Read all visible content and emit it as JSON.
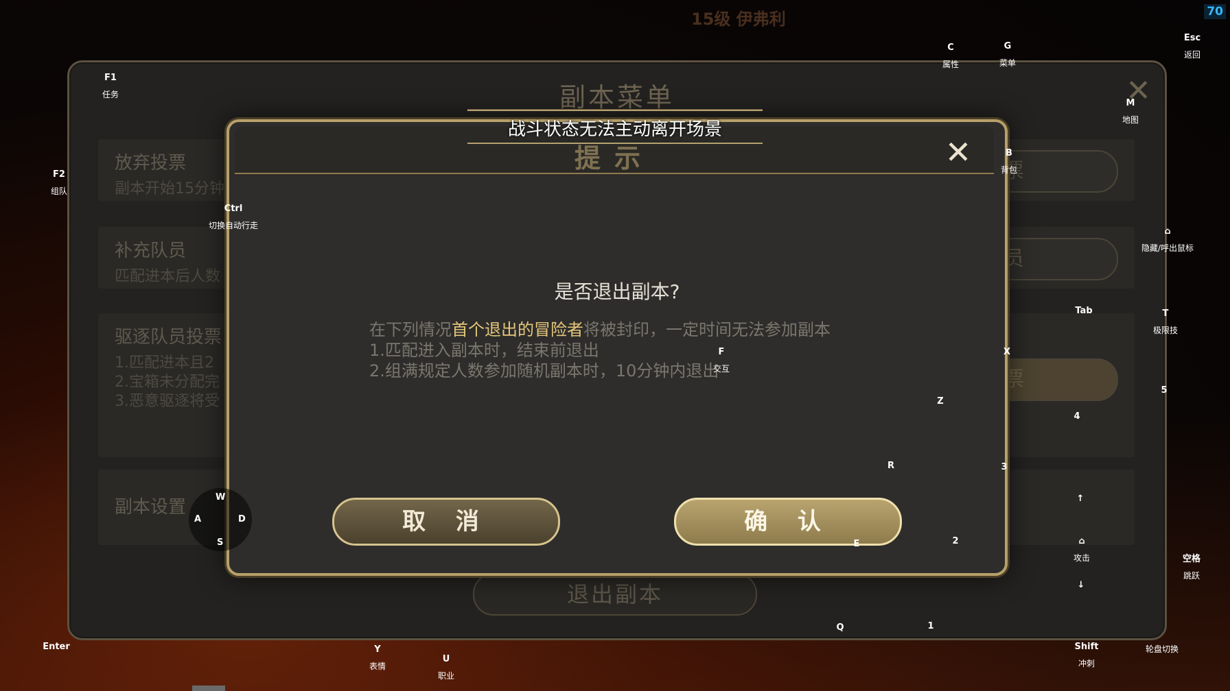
{
  "top": {
    "level_text": "15级 伊弗利",
    "corner_number": "70"
  },
  "back_panel": {
    "title": "副本菜单",
    "rows": [
      {
        "title": "放弃投票",
        "sub": "副本开始15分钟",
        "button": "投票"
      },
      {
        "title": "补充队员",
        "sub": "匹配进本后人数",
        "button": "队员"
      },
      {
        "title": "驱逐队员投票",
        "lines": [
          "1.匹配进本且2",
          "2.宝箱未分配完",
          "3.恶意驱逐将受"
        ],
        "button": "投票"
      },
      {
        "title": "副本设置"
      }
    ],
    "exit_button": "退出副本"
  },
  "toast": "战斗状态无法主动离开场景",
  "dialog": {
    "title": "提示",
    "question": "是否退出副本?",
    "body_prefix": "在下列情况",
    "body_highlight": "首个退出的冒险者",
    "body_suffix": "将被封印，一定时间无法参加副本",
    "line1": "1.匹配进入副本时，结束前退出",
    "line2": "2.组满规定人数参加随机副本时，10分钟内退出",
    "cancel": "取 消",
    "confirm": "确 认"
  },
  "hints": {
    "f1": {
      "k": "F1",
      "l": "任务"
    },
    "f2": {
      "k": "F2",
      "l": "组队"
    },
    "ctrl": {
      "k": "Ctrl",
      "l": "切换自动行走"
    },
    "c": {
      "k": "C",
      "l": "属性"
    },
    "g": {
      "k": "G",
      "l": "菜单"
    },
    "esc": {
      "k": "Esc",
      "l": "返回"
    },
    "m": {
      "k": "M",
      "l": "地图"
    },
    "b": {
      "k": "B",
      "l": "背包"
    },
    "mouse": {
      "l": "隐藏/呼出鼠标"
    },
    "tab": {
      "k": "Tab"
    },
    "t": {
      "k": "T",
      "l": "极限技"
    },
    "f": {
      "k": "F",
      "l": "交互"
    },
    "x": {
      "k": "X"
    },
    "z": {
      "k": "Z"
    },
    "n5": {
      "k": "5"
    },
    "n4": {
      "k": "4"
    },
    "r": {
      "k": "R"
    },
    "n3": {
      "k": "3"
    },
    "up": {
      "k": "↑"
    },
    "attack": {
      "l": "攻击"
    },
    "space": {
      "k": "空格",
      "l": "跳跃"
    },
    "down": {
      "k": "↓"
    },
    "e": {
      "k": "E"
    },
    "n2": {
      "k": "2"
    },
    "q": {
      "k": "Q"
    },
    "n1": {
      "k": "1"
    },
    "wheel": {
      "l": "轮盘切换"
    },
    "enter": {
      "k": "Enter"
    },
    "y": {
      "k": "Y",
      "l": "表情"
    },
    "u": {
      "k": "U",
      "l": "职业"
    },
    "shift": {
      "k": "Shift",
      "l": "冲刺"
    },
    "dpad": {
      "w": "W",
      "a": "A",
      "s": "S",
      "d": "D"
    }
  }
}
